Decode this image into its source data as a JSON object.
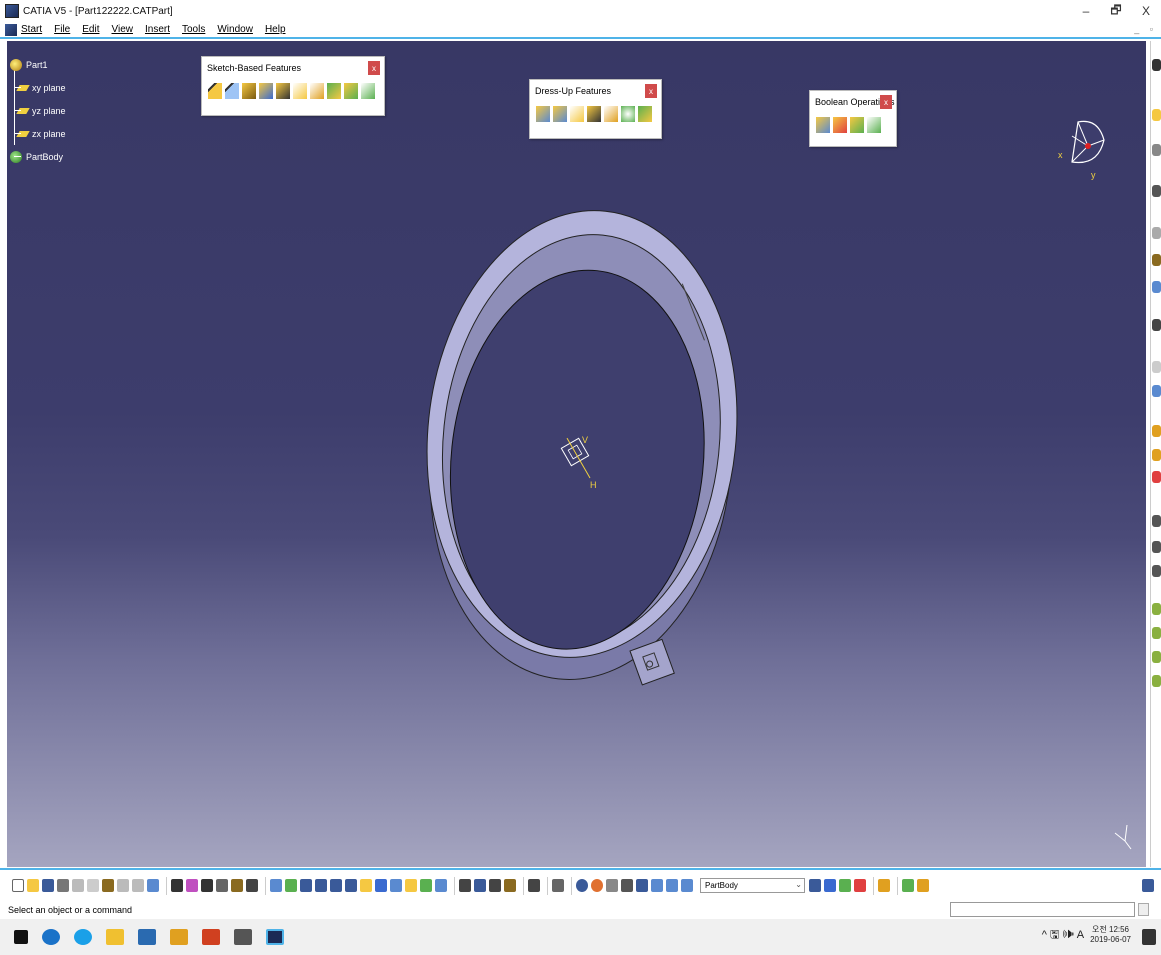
{
  "window": {
    "title": "CATIA V5 - [Part122222.CATPart]",
    "minimize": "–",
    "restore": "🗗",
    "close": "X"
  },
  "menu": {
    "items": [
      "Start",
      "File",
      "Edit",
      "View",
      "Insert",
      "Tools",
      "Window",
      "Help"
    ],
    "mdi_controls": "_ ▫"
  },
  "spec_tree": {
    "root": "Part1",
    "planes": [
      "xy plane",
      "yz plane",
      "zx plane"
    ],
    "body": "PartBody"
  },
  "toolbars": {
    "sketch_based": {
      "title": "Sketch-Based Features",
      "close": "x"
    },
    "dress_up": {
      "title": "Dress-Up Features",
      "close": "x"
    },
    "boolean": {
      "title": "Boolean Operations",
      "close": "x"
    }
  },
  "compass": {
    "x_label": "x",
    "y_label": "y"
  },
  "sketch_axis": {
    "v_label": "V",
    "h_label": "H"
  },
  "bottom_toolbar": {
    "current_body": "PartBody"
  },
  "status": {
    "message": "Select an object or a command"
  },
  "taskbar": {
    "tray_icons": "^ 🖫 🕪 A",
    "time": "오전 12:56",
    "date": "2019-06-07"
  },
  "colors": {
    "viewport_top": "#383865",
    "viewport_bottom": "#a5a5c0",
    "ring_fill": "#b4b4dc",
    "accent": "#4fb3e8"
  }
}
